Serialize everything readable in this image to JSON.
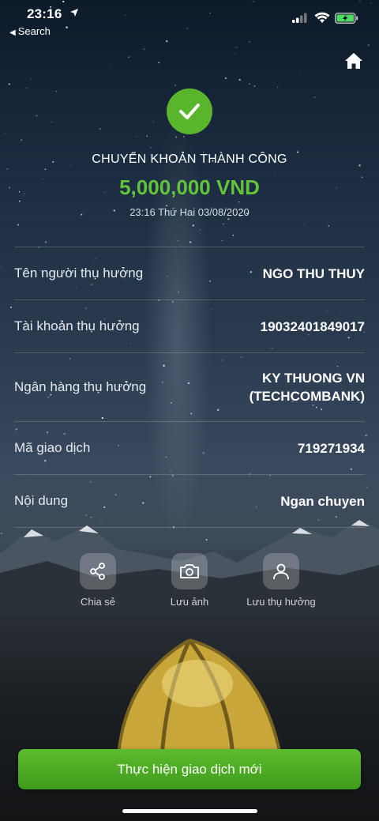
{
  "status_bar": {
    "time": "23:16",
    "back_label": "Search"
  },
  "header": {
    "home_icon": "home-icon"
  },
  "result": {
    "title": "CHUYỂN KHOẢN THÀNH CÔNG",
    "amount": "5,000,000 VND",
    "datetime": "23:16 Thứ Hai 03/08/2020",
    "accent_color": "#63c33a"
  },
  "details": [
    {
      "label": "Tên người thụ hưởng",
      "value": "NGO THU THUY"
    },
    {
      "label": "Tài khoản thụ hưởng",
      "value": "19032401849017"
    },
    {
      "label": "Ngân hàng thụ hưởng",
      "value_line1": "KY THUONG VN",
      "value_line2": "(TECHCOMBANK)"
    },
    {
      "label": "Mã giao dịch",
      "value": "719271934"
    },
    {
      "label": "Nội dung",
      "value": "Ngan chuyen"
    }
  ],
  "actions": [
    {
      "label": "Chia sẻ",
      "icon": "share-icon"
    },
    {
      "label": "Lưu ảnh",
      "icon": "camera-icon"
    },
    {
      "label": "Lưu thụ hưởng",
      "icon": "user-icon"
    }
  ],
  "cta": {
    "label": "Thực hiện giao dịch mới",
    "color": "#4caf22"
  }
}
